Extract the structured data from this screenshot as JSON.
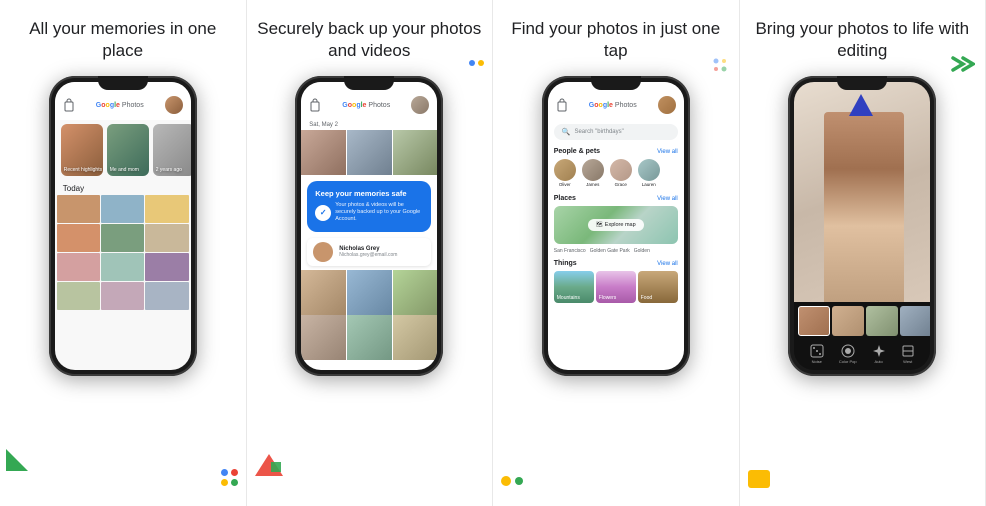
{
  "panels": [
    {
      "id": "memories",
      "title": "All your memories\nin one place",
      "chips": [
        {
          "label": "Recent highlights",
          "colorClass": "chip1"
        },
        {
          "label": "Me and mom",
          "colorClass": "chip2"
        },
        {
          "label": "2 years ago",
          "colorClass": "chip3"
        }
      ],
      "sectionLabel": "Today",
      "gridColors": [
        "c1",
        "c2",
        "c3",
        "c4",
        "c5",
        "c6",
        "c7",
        "c8",
        "c9",
        "c10",
        "c11",
        "c12"
      ]
    },
    {
      "id": "backup",
      "title": "Securely back up your\nphotos and videos",
      "cardTitle": "Keep your memories safe",
      "cardText": "Your photos & videos will be securely backed up to your Google Account.",
      "personName": "Nicholas Grey",
      "personSub": "Nicholas.grey@email.com"
    },
    {
      "id": "search",
      "title": "Find your photos\nin just one tap",
      "searchPlaceholder": "Search \"birthdays\"",
      "sections": {
        "people": {
          "label": "People & pets",
          "viewAll": "View all",
          "persons": [
            "Oliver",
            "James",
            "Grace",
            "Lauren"
          ]
        },
        "places": {
          "label": "Places",
          "viewAll": "View all",
          "mapButton": "Explore map",
          "locations": [
            "San Francisco",
            "Golden Gate Park",
            "Golden"
          ]
        },
        "things": {
          "label": "Things",
          "viewAll": "View all",
          "items": [
            "Mountains",
            "Flowers",
            "Food"
          ]
        }
      }
    },
    {
      "id": "editing",
      "title": "Bring your photos\nto life with editing",
      "tools": [
        {
          "icon": "⬡",
          "label": "Noise"
        },
        {
          "icon": "👤",
          "label": "Color Pop"
        },
        {
          "icon": "✦",
          "label": "Auto"
        },
        {
          "icon": "◇",
          "label": "West"
        }
      ]
    }
  ],
  "decorations": {
    "panel1": {
      "bottomLeft": {
        "type": "triangle",
        "color": "#34a853"
      },
      "bottomRight": {
        "type": "dots",
        "colors": [
          "#4285f4",
          "#ea4335",
          "#fbbc04",
          "#34a853"
        ]
      }
    },
    "panel2": {
      "topRight": {
        "type": "dots",
        "colors": [
          "#4285f4",
          "#fbbc04"
        ]
      },
      "bottomLeft": {
        "type": "shapes",
        "colors": [
          "#ea4335",
          "#34a853"
        ]
      }
    },
    "panel3": {
      "topRight": {
        "type": "dots"
      },
      "bottomLeft": {
        "type": "dots",
        "colors": [
          "#fbbc04",
          "#34a853"
        ]
      }
    },
    "panel4": {
      "topRight": {
        "type": "chevron",
        "color": "#34a853"
      },
      "bottomLeft": {
        "type": "rect",
        "color": "#fbbc04"
      }
    }
  }
}
